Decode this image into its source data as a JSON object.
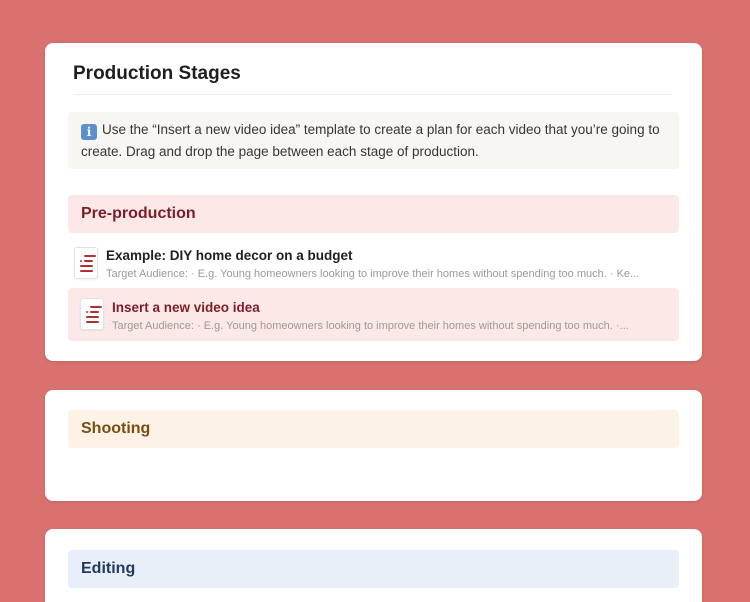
{
  "colors": {
    "background": "#d9726e",
    "pre_production": "#fde8e8",
    "shooting": "#fdf2e6",
    "editing": "#e8eff9"
  },
  "page": {
    "title": "Production Stages"
  },
  "callout": {
    "icon": "info-icon",
    "icon_glyph": "i",
    "text": "Use the “Insert a new video idea” template to create a plan for each video that you’re going to create. Drag and drop the page between each stage of production."
  },
  "stages": {
    "pre_production": {
      "label": "Pre-production",
      "items": [
        {
          "icon": "document-icon",
          "title": "Example: DIY home decor on a budget",
          "subtitle": "Target Audience:  · E.g. Young homeowners looking to improve their homes without spending too much.  · Ke..."
        },
        {
          "icon": "document-icon",
          "title": "Insert a new video idea",
          "subtitle": "Target Audience:  · E.g. Young homeowners looking to improve their homes without spending too much.  ·..."
        }
      ]
    },
    "shooting": {
      "label": "Shooting"
    },
    "editing": {
      "label": "Editing"
    }
  }
}
